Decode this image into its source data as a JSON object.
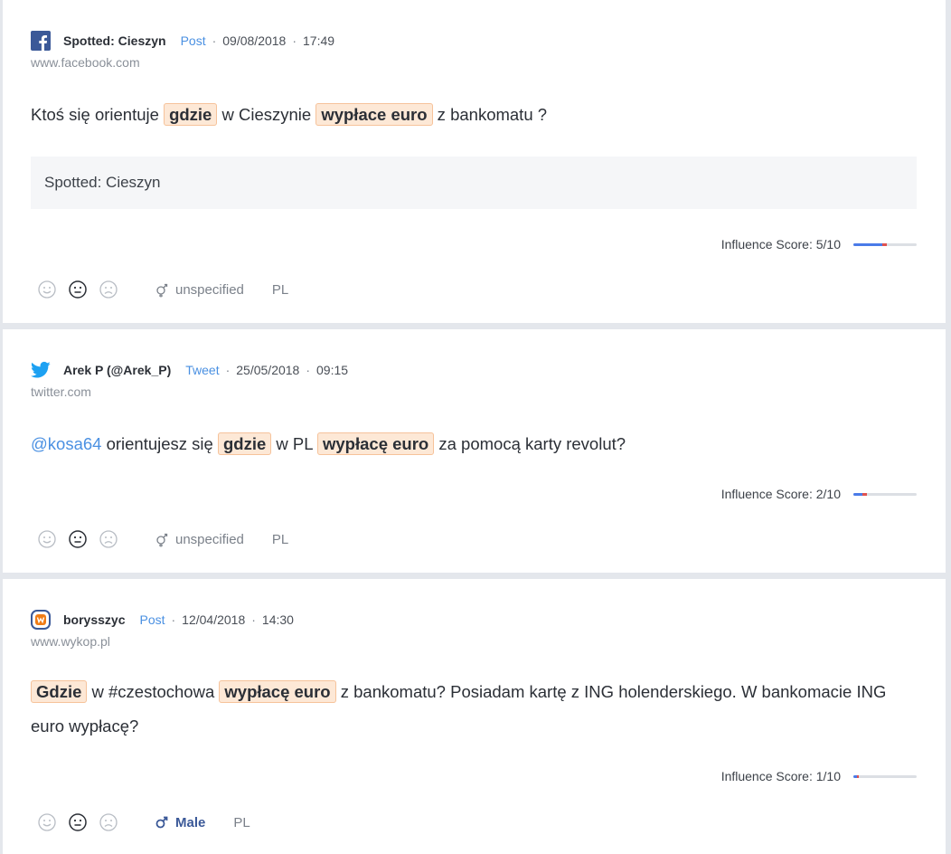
{
  "posts": [
    {
      "source": "facebook-icon",
      "author": "Spotted: Cieszyn",
      "kind": "Post",
      "date": "09/08/2018",
      "time": "17:49",
      "domain": "www.facebook.com",
      "text_parts": [
        "Ktoś się orientuje ",
        "gdzie",
        " w Cieszynie ",
        "wypłace euro",
        " z bankomatu ?"
      ],
      "quote": "Spotted: Cieszyn",
      "influence": "Influence Score: 5/10",
      "influence_value": 5,
      "gender": "unspecified",
      "lang": "PL"
    },
    {
      "source": "twitter-icon",
      "author": "Arek P (@Arek_P)",
      "kind": "Tweet",
      "date": "25/05/2018",
      "time": "09:15",
      "domain": "twitter.com",
      "text_parts": [
        "@kosa64",
        " orientujesz się ",
        "gdzie",
        " w PL ",
        "wypłacę euro",
        " za pomocą karty revolut?"
      ],
      "influence": "Influence Score: 2/10",
      "influence_value": 2,
      "gender": "unspecified",
      "lang": "PL"
    },
    {
      "source": "wykop-icon",
      "author": "borysszyc",
      "kind": "Post",
      "date": "12/04/2018",
      "time": "14:30",
      "domain": "www.wykop.pl",
      "text_parts": [
        "Gdzie",
        " w #czestochowa ",
        "wypłacę euro",
        " z bankomatu? Posiadam kartę z ING holenderskiego. W bankomacie ING euro wypłacę?"
      ],
      "influence": "Influence Score: 1/10",
      "influence_value": 1,
      "gender": "Male",
      "lang": "PL"
    }
  ],
  "separator": "·",
  "colors": {
    "accent": "#4a90e2",
    "highlight_bg": "#fde8d6",
    "highlight_border": "#f6c39b",
    "facebook": "#3b5998",
    "twitter": "#1da1f2",
    "wykop": "#f07c16",
    "male": "#3b5998"
  }
}
